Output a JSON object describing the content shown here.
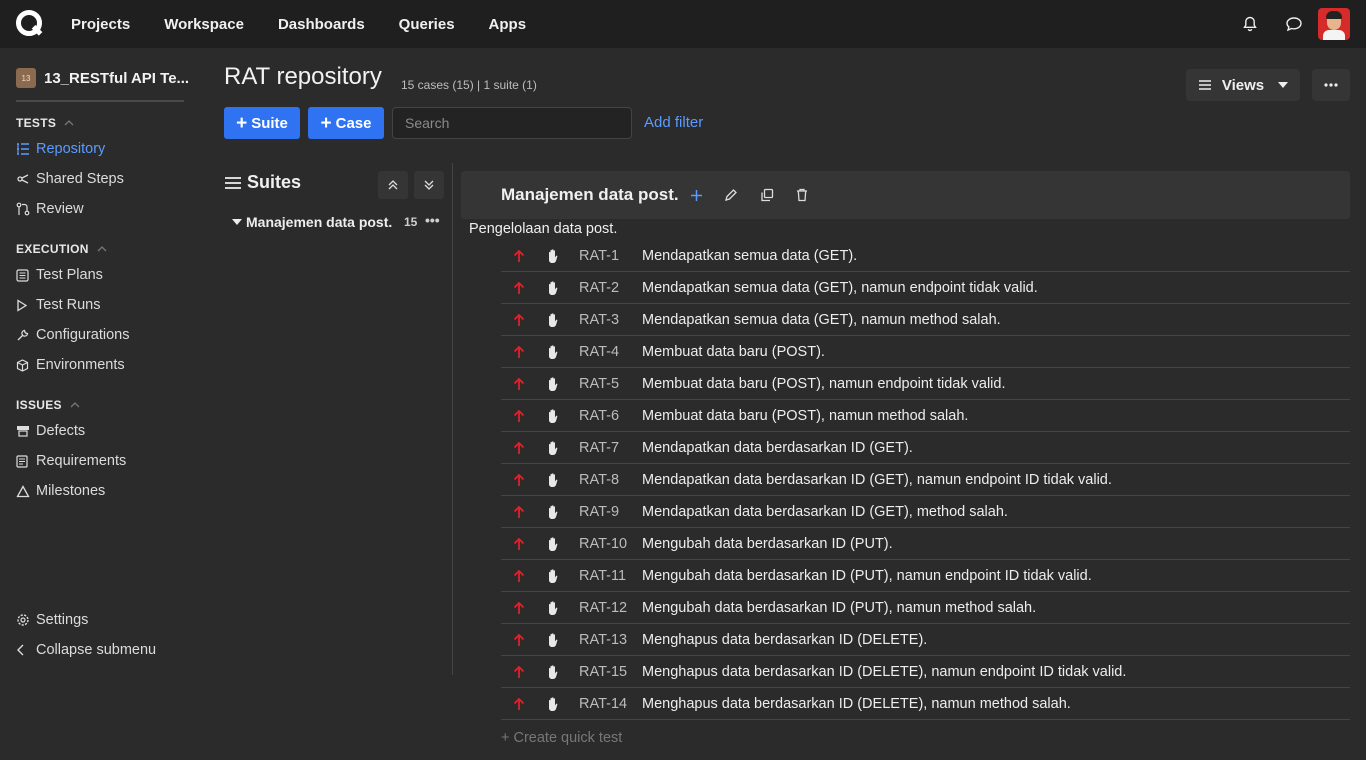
{
  "topnav": {
    "items": [
      "Projects",
      "Workspace",
      "Dashboards",
      "Queries",
      "Apps"
    ]
  },
  "sidebar": {
    "project_badge": "13",
    "project_name": "13_RESTful API Te...",
    "tests_title": "TESTS",
    "tests_items": [
      {
        "label": "Repository",
        "icon": "repository-icon",
        "active": true
      },
      {
        "label": "Shared Steps",
        "icon": "shared-steps-icon"
      },
      {
        "label": "Review",
        "icon": "review-icon"
      }
    ],
    "execution_title": "EXECUTION",
    "execution_items": [
      {
        "label": "Test Plans",
        "icon": "test-plans-icon"
      },
      {
        "label": "Test Runs",
        "icon": "play-icon"
      },
      {
        "label": "Configurations",
        "icon": "wrench-icon"
      },
      {
        "label": "Environments",
        "icon": "cube-icon"
      }
    ],
    "issues_title": "ISSUES",
    "issues_items": [
      {
        "label": "Defects",
        "icon": "defects-icon"
      },
      {
        "label": "Requirements",
        "icon": "requirements-icon"
      },
      {
        "label": "Milestones",
        "icon": "milestone-icon"
      }
    ],
    "settings": "Settings",
    "collapse": "Collapse submenu"
  },
  "header": {
    "title": "RAT repository",
    "meta": "15 cases (15) | 1 suite (1)",
    "views": "Views",
    "add_suite": "Suite",
    "add_case": "Case",
    "search_placeholder": "Search",
    "add_filter": "Add filter"
  },
  "suites_panel": {
    "title": "Suites",
    "tree": [
      {
        "name": "Manajemen data post.",
        "count": "15"
      }
    ]
  },
  "suite": {
    "title": "Manajemen data post.",
    "description": "Pengelolaan data post.",
    "cases": [
      {
        "id": "RAT-1",
        "title": "Mendapatkan semua data (GET)."
      },
      {
        "id": "RAT-2",
        "title": "Mendapatkan semua data (GET), namun endpoint tidak valid."
      },
      {
        "id": "RAT-3",
        "title": "Mendapatkan semua data (GET), namun method salah."
      },
      {
        "id": "RAT-4",
        "title": "Membuat data baru (POST)."
      },
      {
        "id": "RAT-5",
        "title": "Membuat data baru (POST), namun endpoint tidak valid."
      },
      {
        "id": "RAT-6",
        "title": "Membuat data baru (POST), namun method salah."
      },
      {
        "id": "RAT-7",
        "title": "Mendapatkan data berdasarkan ID (GET)."
      },
      {
        "id": "RAT-8",
        "title": "Mendapatkan data berdasarkan ID (GET), namun endpoint ID tidak valid."
      },
      {
        "id": "RAT-9",
        "title": "Mendapatkan data berdasarkan ID (GET), method salah."
      },
      {
        "id": "RAT-10",
        "title": "Mengubah data berdasarkan ID (PUT)."
      },
      {
        "id": "RAT-11",
        "title": "Mengubah data berdasarkan ID (PUT), namun endpoint ID tidak valid."
      },
      {
        "id": "RAT-12",
        "title": "Mengubah data berdasarkan ID (PUT), namun method salah."
      },
      {
        "id": "RAT-13",
        "title": "Menghapus data berdasarkan ID (DELETE)."
      },
      {
        "id": "RAT-15",
        "title": "Menghapus data berdasarkan ID (DELETE), namun endpoint ID tidak valid."
      },
      {
        "id": "RAT-14",
        "title": "Menghapus data berdasarkan ID (DELETE), namun method salah."
      }
    ],
    "quick_test": "+ Create quick test"
  },
  "colors": {
    "accent": "#2f73f3",
    "link": "#5b9bff",
    "priority_high": "#e0222b"
  }
}
